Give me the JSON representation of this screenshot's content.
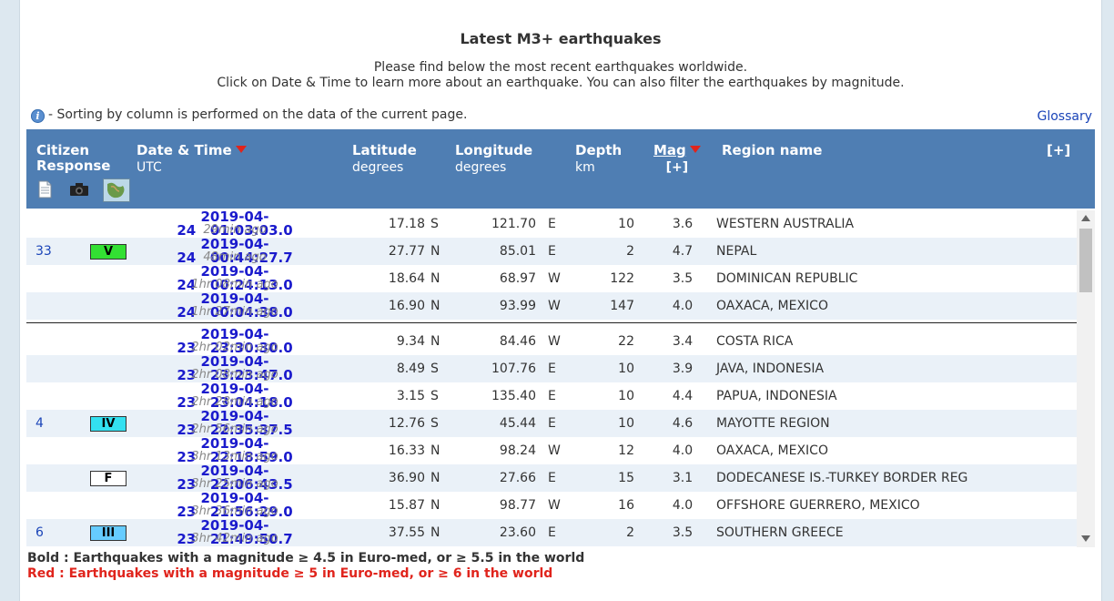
{
  "title": "Latest M3+ earthquakes",
  "intro_line1": "Please find below the most recent earthquakes worldwide.",
  "intro_line2": "Click on Date & Time to learn more about an earthquake. You can also filter the earthquakes by magnitude.",
  "info_text": "- Sorting by column is performed on the data of the current page.",
  "glossary": "Glossary",
  "headers": {
    "citizen": "Citizen",
    "response": "Response",
    "datetime": "Date & Time",
    "datetime_sub": "UTC",
    "latitude": "Latitude",
    "latitude_sub": "degrees",
    "longitude": "Longitude",
    "longitude_sub": "degrees",
    "depth": "Depth",
    "depth_sub": "km",
    "mag": "Mag",
    "mag_sub": "[+]",
    "region": "Region name",
    "expand": "[+]"
  },
  "header_icons": [
    "document-icon",
    "camera-icon",
    "map-icon"
  ],
  "rows": [
    {
      "count": "",
      "intensity": "",
      "date": "2019-04-24",
      "time": "01:03:03.0",
      "ago": "29min ago",
      "lat": "17.18",
      "lat_dir": "S",
      "lon": "121.70",
      "lon_dir": "E",
      "depth": "10",
      "mag": "3.6",
      "region": "WESTERN AUSTRALIA"
    },
    {
      "count": "33",
      "intensity": "V",
      "date": "2019-04-24",
      "time": "00:44:27.7",
      "ago": "48min ago",
      "lat": "27.77",
      "lat_dir": "N",
      "lon": "85.01",
      "lon_dir": "E",
      "depth": "2",
      "mag": "4.7",
      "region": "NEPAL"
    },
    {
      "count": "",
      "intensity": "",
      "date": "2019-04-24",
      "time": "00:24:13.0",
      "ago": "1hr 08min ago",
      "lat": "18.64",
      "lat_dir": "N",
      "lon": "68.97",
      "lon_dir": "W",
      "depth": "122",
      "mag": "3.5",
      "region": "DOMINICAN REPUBLIC"
    },
    {
      "count": "",
      "intensity": "",
      "date": "2019-04-24",
      "time": "00:04:38.0",
      "ago": "1hr 27min ago",
      "lat": "16.90",
      "lat_dir": "N",
      "lon": "93.99",
      "lon_dir": "W",
      "depth": "147",
      "mag": "4.0",
      "region": "OAXACA, MEXICO"
    },
    {
      "count": "",
      "intensity": "",
      "date": "2019-04-23",
      "time": "23:30:30.0",
      "ago": "2hr 02min ago",
      "lat": "9.34",
      "lat_dir": "N",
      "lon": "84.46",
      "lon_dir": "W",
      "depth": "22",
      "mag": "3.4",
      "region": "COSTA RICA"
    },
    {
      "count": "",
      "intensity": "",
      "date": "2019-04-23",
      "time": "23:23:47.0",
      "ago": "2hr 08min ago",
      "lat": "8.49",
      "lat_dir": "S",
      "lon": "107.76",
      "lon_dir": "E",
      "depth": "10",
      "mag": "3.9",
      "region": "JAVA, INDONESIA"
    },
    {
      "count": "",
      "intensity": "",
      "date": "2019-04-23",
      "time": "23:04:18.0",
      "ago": "2hr 28min ago",
      "lat": "3.15",
      "lat_dir": "S",
      "lon": "135.40",
      "lon_dir": "E",
      "depth": "10",
      "mag": "4.4",
      "region": "PAPUA, INDONESIA"
    },
    {
      "count": "4",
      "intensity": "IV",
      "date": "2019-04-23",
      "time": "22:35:37.5",
      "ago": "2hr 56min ago",
      "lat": "12.76",
      "lat_dir": "S",
      "lon": "45.44",
      "lon_dir": "E",
      "depth": "10",
      "mag": "4.6",
      "region": "MAYOTTE REGION"
    },
    {
      "count": "",
      "intensity": "",
      "date": "2019-04-23",
      "time": "22:18:59.0",
      "ago": "3hr 13min ago",
      "lat": "16.33",
      "lat_dir": "N",
      "lon": "98.24",
      "lon_dir": "W",
      "depth": "12",
      "mag": "4.0",
      "region": "OAXACA, MEXICO"
    },
    {
      "count": "",
      "intensity": "F",
      "date": "2019-04-23",
      "time": "22:06:43.5",
      "ago": "3hr 25min ago",
      "lat": "36.90",
      "lat_dir": "N",
      "lon": "27.66",
      "lon_dir": "E",
      "depth": "15",
      "mag": "3.1",
      "region": "DODECANESE IS.-TURKEY BORDER REG"
    },
    {
      "count": "",
      "intensity": "",
      "date": "2019-04-23",
      "time": "21:56:29.0",
      "ago": "3hr 36min ago",
      "lat": "15.87",
      "lat_dir": "N",
      "lon": "98.77",
      "lon_dir": "W",
      "depth": "16",
      "mag": "4.0",
      "region": "OFFSHORE GUERRERO, MEXICO"
    },
    {
      "count": "6",
      "intensity": "III",
      "date": "2019-04-23",
      "time": "21:49:50.7",
      "ago": "3hr 42min ago",
      "lat": "37.55",
      "lat_dir": "N",
      "lon": "23.60",
      "lon_dir": "E",
      "depth": "2",
      "mag": "3.5",
      "region": "SOUTHERN GREECE"
    }
  ],
  "intensity_colors": {
    "V": "#33e033",
    "IV": "#33e0f0",
    "III": "#66ccff",
    "F": "#ffffff"
  },
  "legend_bold": "Bold : Earthquakes with a magnitude ≥ 4.5 in Euro-med, or ≥ 5.5 in the world",
  "legend_red": "Red : Earthquakes with a magnitude ≥ 5 in Euro-med, or ≥ 6 in the world"
}
